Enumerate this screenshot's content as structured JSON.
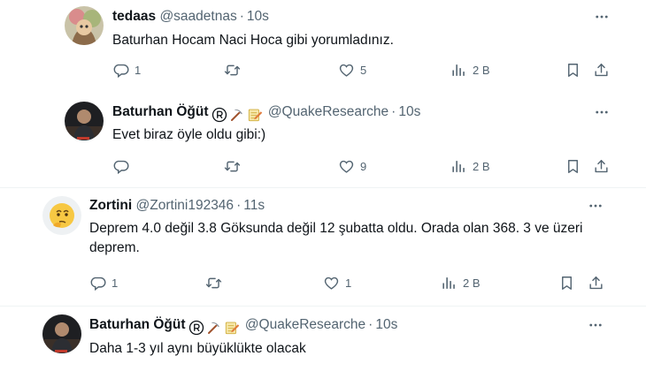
{
  "tweets": [
    {
      "name": "tedaas",
      "handle": "@saadetnas",
      "time": "10s",
      "text": "Baturhan Hocam Naci Hoca gibi yorumladınız.",
      "replies": "1",
      "retweets": "",
      "likes": "5",
      "views": "2 B"
    },
    {
      "name": "Baturhan Öğüt",
      "handle": "@QuakeResearche",
      "time": "10s",
      "text": "Evet biraz öyle oldu gibi:)",
      "replies": "",
      "retweets": "",
      "likes": "9",
      "views": "2 B"
    },
    {
      "name": "Zortini",
      "handle": "@Zortini192346",
      "time": "11s",
      "text": "Deprem 4.0 değil 3.8 Göksunda değil 12 şubatta oldu. Orada olan 368.   3 ve üzeri deprem.",
      "replies": "1",
      "retweets": "",
      "likes": "1",
      "views": "2 B"
    },
    {
      "name": "Baturhan Öğüt",
      "handle": "@QuakeResearche",
      "time": "10s",
      "text": "Daha 1-3 yıl aynı büyüklükte olacak"
    }
  ],
  "icons": {
    "reply": "speech-bubble-icon",
    "retweet": "retweet-arrows-icon",
    "like": "heart-icon",
    "views": "bar-chart-icon",
    "bookmark": "bookmark-icon",
    "share": "share-upload-icon",
    "more": "more-dots-icon",
    "badges": [
      "registered-icon",
      "pickaxe-icon",
      "memo-icon"
    ]
  },
  "colors": {
    "text": "#0f1419",
    "muted": "#536471",
    "divider": "#eff3f4"
  }
}
